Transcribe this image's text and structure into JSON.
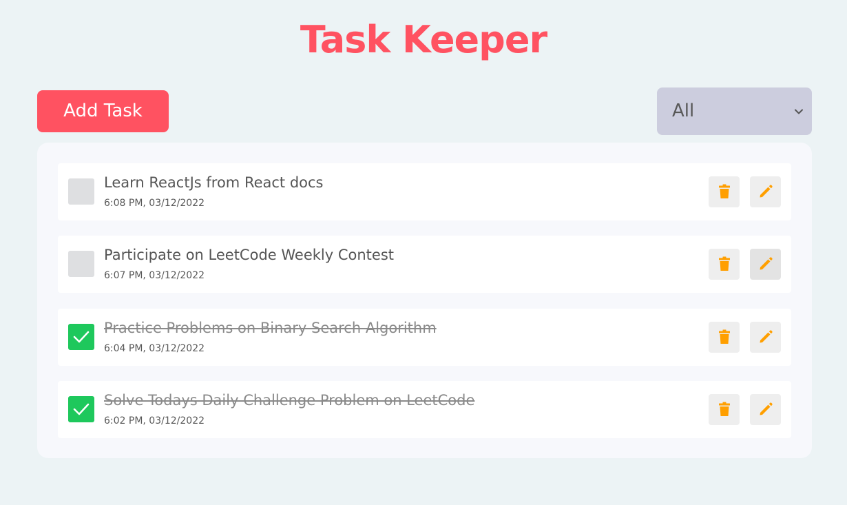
{
  "app": {
    "title": "Task Keeper"
  },
  "toolbar": {
    "add_task_label": "Add Task",
    "filter_selected": "All"
  },
  "colors": {
    "brand": "#ff5261",
    "checked": "#1ec85c",
    "icon": "#ff9f00",
    "filter_bg": "#cccdde"
  },
  "icons": {
    "delete": "trash-icon",
    "edit": "pencil-icon",
    "checkbox_checked": "check-icon",
    "filter": "chevron-down-icon"
  },
  "tasks": [
    {
      "title": "Learn ReactJs from React docs",
      "time": "6:08 PM, 03/12/2022",
      "completed": false
    },
    {
      "title": "Participate on LeetCode Weekly Contest",
      "time": "6:07 PM, 03/12/2022",
      "completed": false
    },
    {
      "title": "Practice Problems on Binary Search Algorithm",
      "time": "6:04 PM, 03/12/2022",
      "completed": true
    },
    {
      "title": "Solve Todays Daily Challenge Problem on LeetCode",
      "time": "6:02 PM, 03/12/2022",
      "completed": true
    }
  ]
}
